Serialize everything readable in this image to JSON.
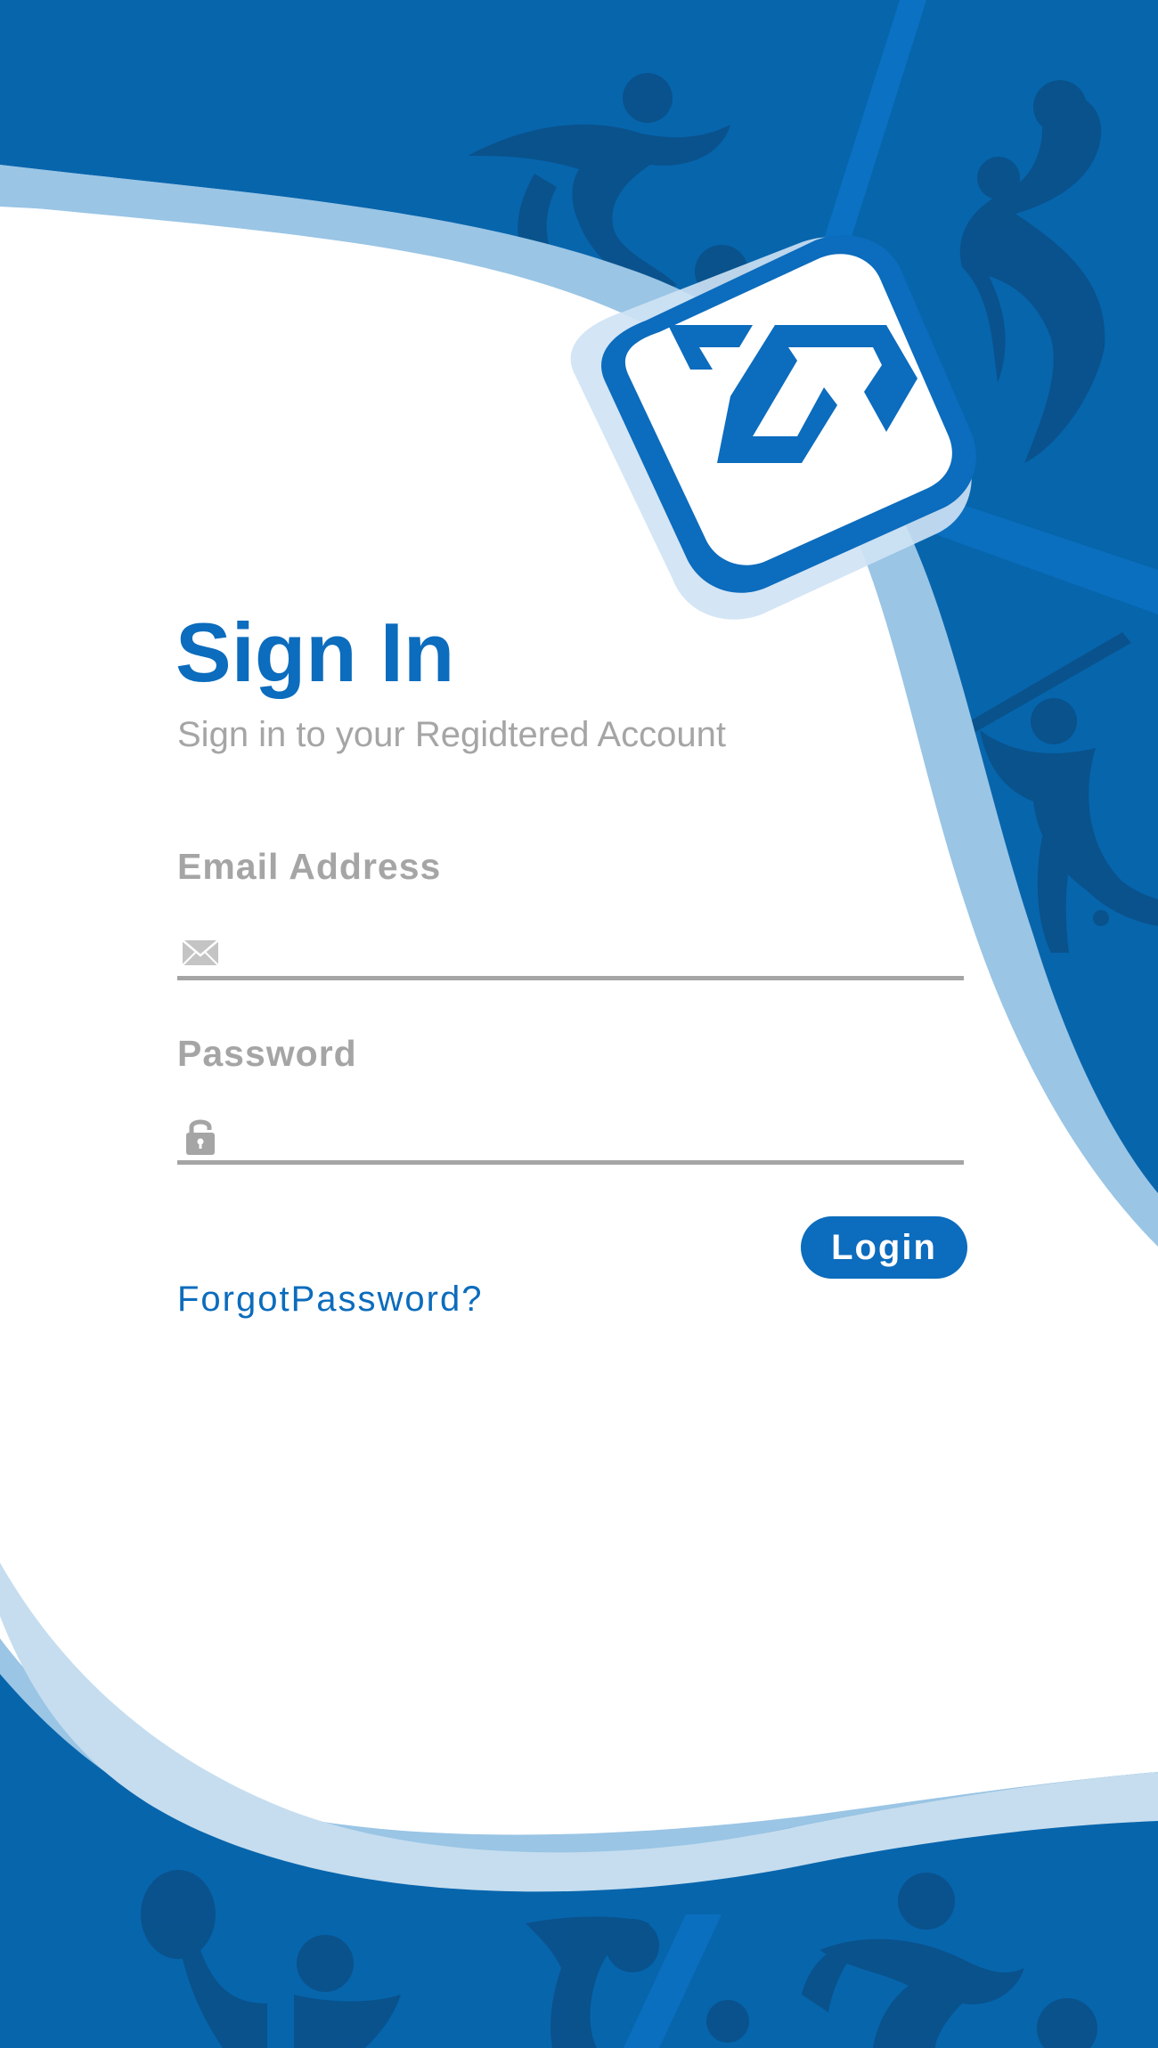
{
  "theme": {
    "primary": "#0c6cbd",
    "background_blue": "#0765ac",
    "light_blue": "#9ac5e5",
    "muted_text": "#a5a5a5",
    "card_background": "#ffffff"
  },
  "logo": {
    "icon": "app-logo-icon"
  },
  "sign_in": {
    "title": "Sign In",
    "subtitle": "Sign in to your Regidtered Account"
  },
  "form": {
    "email": {
      "label": "Email Address",
      "value": "",
      "placeholder": "",
      "icon": "envelope-icon"
    },
    "password": {
      "label": "Password",
      "value": "",
      "placeholder": "",
      "icon": "lock-icon"
    },
    "login_label": "Login",
    "forgot_label": "ForgotPassword?"
  }
}
